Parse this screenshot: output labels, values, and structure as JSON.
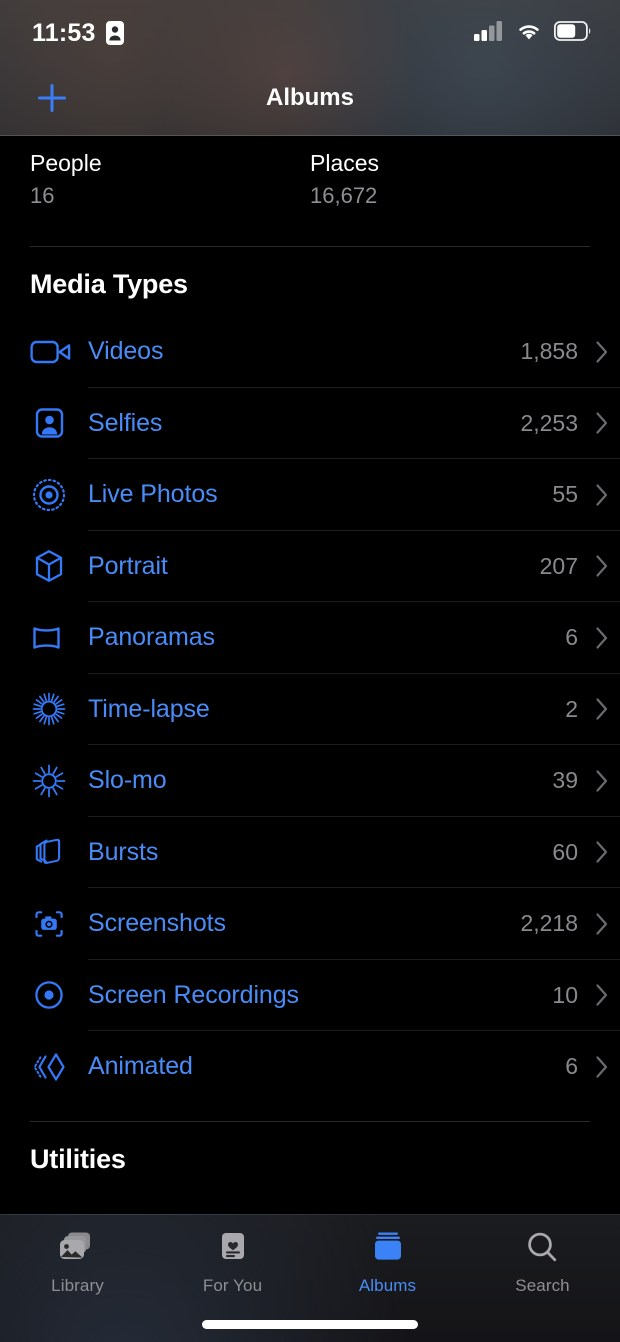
{
  "status_bar": {
    "time": "11:53",
    "privacy_icon": "id-badge-icon",
    "cellular_icon": "cellular-bars-icon",
    "wifi_icon": "wifi-icon",
    "battery_icon": "battery-icon"
  },
  "nav_bar": {
    "title": "Albums",
    "add_icon": "plus-icon"
  },
  "album_captions": [
    {
      "title": "People",
      "count": "16"
    },
    {
      "title": "Places",
      "count": "16,672"
    }
  ],
  "sections": [
    {
      "title": "Media Types",
      "items": [
        {
          "label": "Videos",
          "count": "1,858",
          "icon": "video-camera-icon"
        },
        {
          "label": "Selfies",
          "count": "2,253",
          "icon": "selfie-person-icon"
        },
        {
          "label": "Live Photos",
          "count": "55",
          "icon": "live-photo-icon"
        },
        {
          "label": "Portrait",
          "count": "207",
          "icon": "cube-icon"
        },
        {
          "label": "Panoramas",
          "count": "6",
          "icon": "panorama-icon"
        },
        {
          "label": "Time-lapse",
          "count": "2",
          "icon": "timelapse-icon"
        },
        {
          "label": "Slo-mo",
          "count": "39",
          "icon": "slomo-icon"
        },
        {
          "label": "Bursts",
          "count": "60",
          "icon": "bursts-icon"
        },
        {
          "label": "Screenshots",
          "count": "2,218",
          "icon": "screenshot-camera-icon"
        },
        {
          "label": "Screen Recordings",
          "count": "10",
          "icon": "screen-recording-icon"
        },
        {
          "label": "Animated",
          "count": "6",
          "icon": "animated-icon"
        }
      ]
    },
    {
      "title": "Utilities",
      "items": []
    }
  ],
  "tab_bar": {
    "tabs": [
      {
        "label": "Library",
        "icon": "photo-stack-icon",
        "active": false
      },
      {
        "label": "For You",
        "icon": "heart-card-icon",
        "active": false
      },
      {
        "label": "Albums",
        "icon": "albums-book-icon",
        "active": true
      },
      {
        "label": "Search",
        "icon": "magnifier-icon",
        "active": false
      }
    ]
  },
  "colors": {
    "accent": "#4a8cf7",
    "background": "#000000",
    "secondary_text": "#8e8e93",
    "separator": "#1d1d1f"
  },
  "chevron_icon": "chevron-right-icon",
  "home_indicator": "home-indicator"
}
